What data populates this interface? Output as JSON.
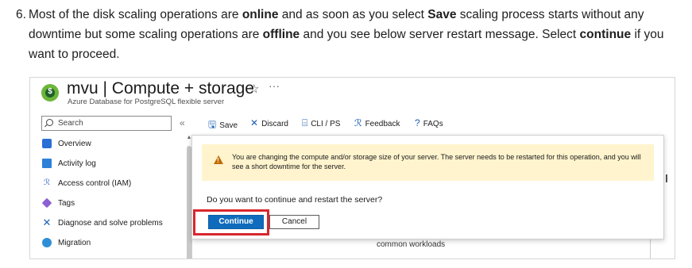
{
  "step": {
    "number": "6.",
    "line1_a": "Most of the disk scaling operations are ",
    "line1_b": "online",
    "line1_c": " and as soon as you select ",
    "line1_d": "Save",
    "line1_e": " scaling process starts without any",
    "line2_a": "downtime but some scaling operations are ",
    "line2_b": "offline",
    "line2_c": " and you see below server restart message. Select ",
    "line2_d": "continue",
    "line2_e": " if you",
    "line3": "want to proceed."
  },
  "header": {
    "icon_glyph": "$",
    "title": "mvu | Compute + storage",
    "star": "☆",
    "more": "···",
    "subtitle": "Azure Database for PostgreSQL flexible server"
  },
  "sidebar": {
    "search_placeholder": "Search",
    "collapse": "«",
    "items": [
      {
        "label": "Overview",
        "icon": "overview-icon"
      },
      {
        "label": "Activity log",
        "icon": "activity-log-icon"
      },
      {
        "label": "Access control (IAM)",
        "icon": "iam-icon"
      },
      {
        "label": "Tags",
        "icon": "tag-icon"
      },
      {
        "label": "Diagnose and solve problems",
        "icon": "wrench-icon"
      },
      {
        "label": "Migration",
        "icon": "migration-icon"
      }
    ],
    "iam_glyph": "ℛ",
    "diag_glyph": "✕"
  },
  "toolbar": {
    "save": "Save",
    "discard": "Discard",
    "cli": "CLI / PS",
    "feedback": "Feedback",
    "faqs": "FAQs",
    "save_glyph": "🖫",
    "discard_glyph": "✕",
    "cli_glyph": "⌸",
    "feedback_glyph": "ℛ",
    "faqs_glyph": "?"
  },
  "dialog": {
    "warning": "You are changing the compute and/or storage size of your server. The server needs to be restarted for this operation, and you will see a short downtime for the server.",
    "question": "Do you want to continue and restart the server?",
    "continue_label": "Continue",
    "cancel_label": "Cancel"
  },
  "background": {
    "text": "common workloads"
  },
  "colors": {
    "primary": "#0f6cbd",
    "warning_bg": "#fff4ce",
    "highlight": "#d9262c"
  }
}
